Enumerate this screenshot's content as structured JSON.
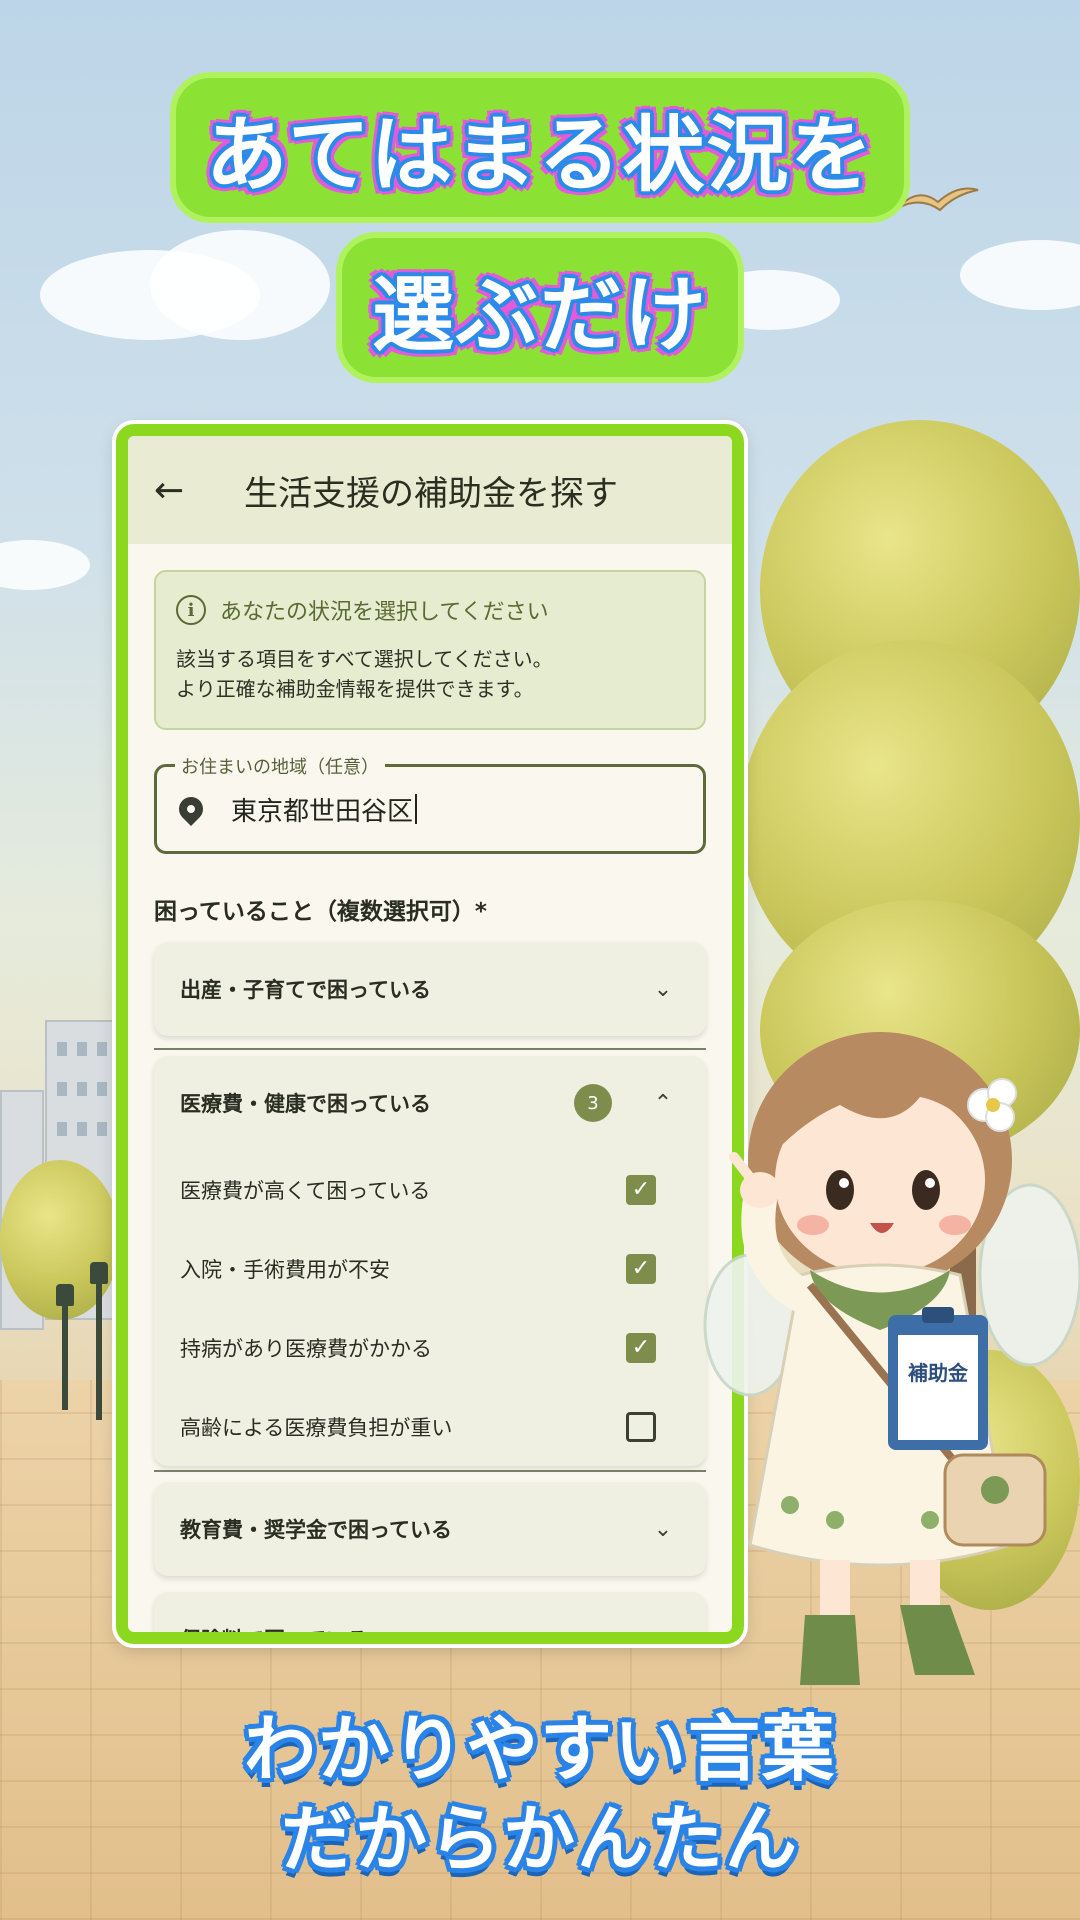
{
  "headline": {
    "line1": "あてはまる状況を",
    "line2": "選ぶだけ"
  },
  "app": {
    "title": "生活支援の補助金を探す",
    "back_icon": "arrow-left-icon"
  },
  "info_box": {
    "heading": "あなたの状況を選択してください",
    "body_line1": "該当する項目をすべて選択してください。",
    "body_line2": "より正確な補助金情報を提供できます。"
  },
  "location_field": {
    "label": "お住まいの地域（任意）",
    "value": "東京都世田谷区"
  },
  "section_title": "困っていること（複数選択可）*",
  "categories": [
    {
      "label": "出産・子育てで困っている",
      "expanded": false
    },
    {
      "label": "医療費・健康で困っている",
      "expanded": true,
      "badge": "3",
      "options": [
        {
          "label": "医療費が高くて困っている",
          "checked": true
        },
        {
          "label": "入院・手術費用が不安",
          "checked": true
        },
        {
          "label": "持病があり医療費がかかる",
          "checked": true
        },
        {
          "label": "高齢による医療費負担が重い",
          "checked": false
        }
      ]
    },
    {
      "label": "教育費・奨学金で困っている",
      "expanded": false
    },
    {
      "label": "保険料で困っている",
      "expanded": false
    }
  ],
  "character": {
    "clipboard_text": "補助金"
  },
  "bottom": {
    "line1": "わかりやすい言葉",
    "line2": "だからかんたん"
  },
  "colors": {
    "accent_green": "#8bd81f",
    "checkbox_green": "#7f8d4c",
    "headline_blue": "#2a8be8",
    "headline_pink": "#e45ad8"
  }
}
